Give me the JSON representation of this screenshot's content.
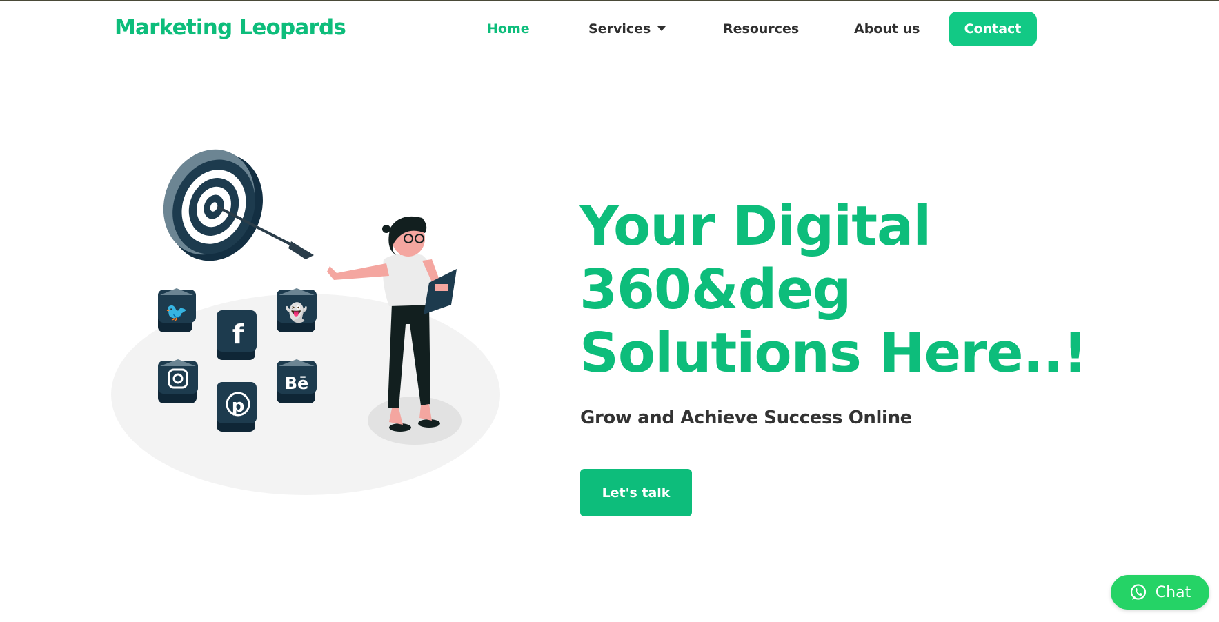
{
  "header": {
    "logo": "Marketing Leopards",
    "nav": {
      "home": "Home",
      "services": "Services",
      "resources": "Resources",
      "about": "About us"
    },
    "contact_label": "Contact"
  },
  "hero": {
    "headline_lines": [
      "Your Digital",
      "360&deg",
      "Solutions Here..!"
    ],
    "subheading": "Grow and Achieve Success Online",
    "cta_label": "Let's talk"
  },
  "illustration": {
    "icons": [
      "target-icon",
      "arrow-icon",
      "twitter-icon",
      "facebook-icon",
      "snapchat-icon",
      "instagram-icon",
      "pinterest-icon",
      "behance-icon",
      "woman-figure"
    ]
  },
  "chat": {
    "label": "Chat",
    "icon": "whatsapp-icon"
  },
  "colors": {
    "brand": "#0dbd7b",
    "chat": "#25d366",
    "text": "#333333",
    "icon_tile": "#1d3b4e"
  }
}
